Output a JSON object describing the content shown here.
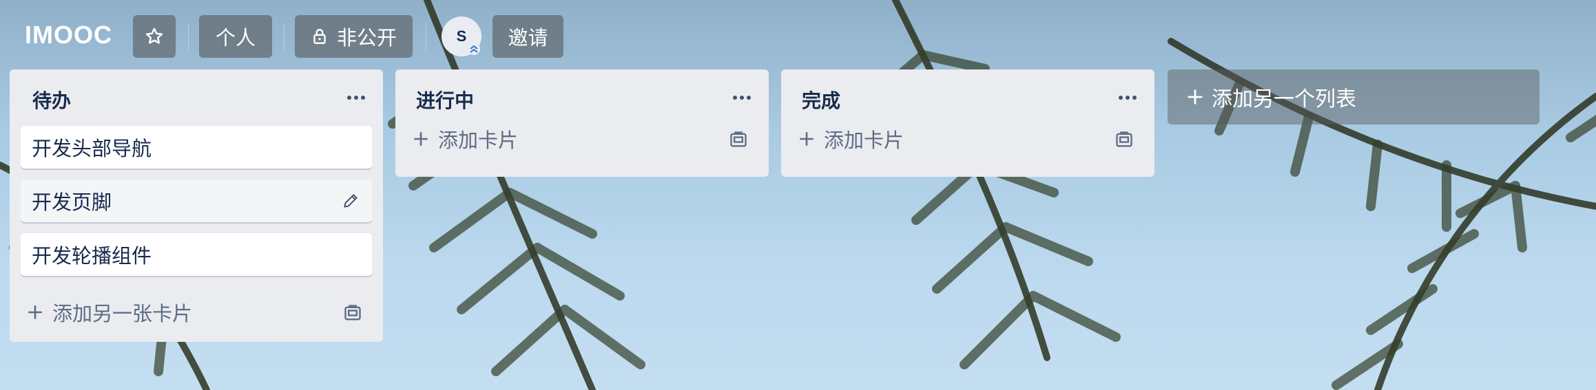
{
  "board": {
    "logo": "IMOOC",
    "visibility_label": "个人",
    "privacy_label": "非公开",
    "member_initial": "S",
    "invite_label": "邀请"
  },
  "lists": [
    {
      "title": "待办",
      "cards": [
        "开发头部导航",
        "开发页脚",
        "开发轮播组件"
      ],
      "add_label": "添加另一张卡片"
    },
    {
      "title": "进行中",
      "cards": [],
      "add_label": "添加卡片"
    },
    {
      "title": "完成",
      "cards": [],
      "add_label": "添加卡片"
    }
  ],
  "add_list_label": "添加另一个列表",
  "icons": {
    "star": "star-icon",
    "lock": "lock-icon",
    "more": "more-horizontal-icon",
    "plus": "plus-icon",
    "template": "card-template-icon",
    "edit": "pencil-icon"
  },
  "colors": {
    "list_bg": "#ebecf0",
    "text": "#172b4d",
    "muted": "#5e6c84"
  }
}
